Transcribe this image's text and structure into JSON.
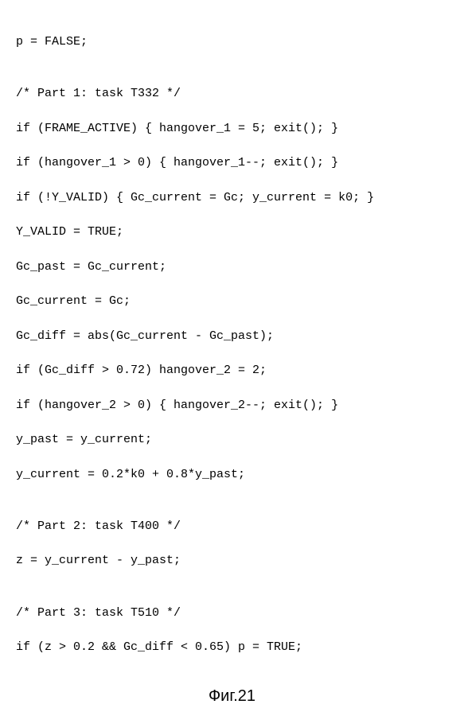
{
  "code": {
    "l0": "p = FALSE;",
    "l1": "",
    "l2": "/* Part 1: task T332 */",
    "l3": "if (FRAME_ACTIVE) { hangover_1 = 5; exit(); }",
    "l4": "if (hangover_1 > 0) { hangover_1--; exit(); }",
    "l5": "if (!Y_VALID) { Gc_current = Gc; y_current = k0; }",
    "l6": "Y_VALID = TRUE;",
    "l7": "Gc_past = Gc_current;",
    "l8": "Gc_current = Gc;",
    "l9": "Gc_diff = abs(Gc_current - Gc_past);",
    "l10": "if (Gc_diff > 0.72) hangover_2 = 2;",
    "l11": "if (hangover_2 > 0) { hangover_2--; exit(); }",
    "l12": "y_past = y_current;",
    "l13": "y_current = 0.2*k0 + 0.8*y_past;",
    "l14": "",
    "l15": "/* Part 2: task T400 */",
    "l16": "z = y_current - y_past;",
    "l17": "",
    "l18": "/* Part 3: task T510 */",
    "l19": "if (z > 0.2 && Gc_diff < 0.65) p = TRUE;"
  },
  "caption": "Фиг.21"
}
